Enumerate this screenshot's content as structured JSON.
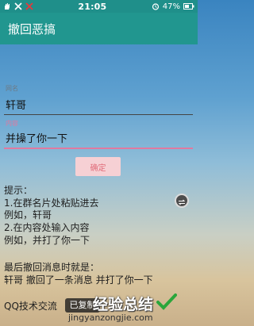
{
  "status_bar": {
    "left_icons": [
      "hand-icon",
      "x-icon",
      "x-icon"
    ],
    "time": "21:05",
    "battery_percent": "47%"
  },
  "app_bar": {
    "title": "撤回恶搞"
  },
  "form": {
    "name": {
      "label": "网名",
      "value": "轩哥"
    },
    "content": {
      "label": "内容",
      "value": "并操了你一下"
    },
    "confirm_label": "确定"
  },
  "tips": {
    "heading": "提示：",
    "line1": "1.在群名片处粘贴进去",
    "line2": "例如，轩哥",
    "line3": "2.在内容处输入内容",
    "line4": "例如，并打了你一下",
    "result_heading": "最后撤回消息时就是：",
    "result_text": "轩哥 撤回了一条消息 并打了你一下",
    "qq_partial": "QQ技术交流"
  },
  "watermark": {
    "overlay_partial": "已复制",
    "brand": "经验总结",
    "url": "jingyanzongjie.com"
  },
  "colors": {
    "status_bar": "#1f8f8a",
    "app_bar": "#21968f",
    "button_bg": "#f6d0d4",
    "button_text": "#e06d7a",
    "active_underline": "#e07aa0"
  }
}
